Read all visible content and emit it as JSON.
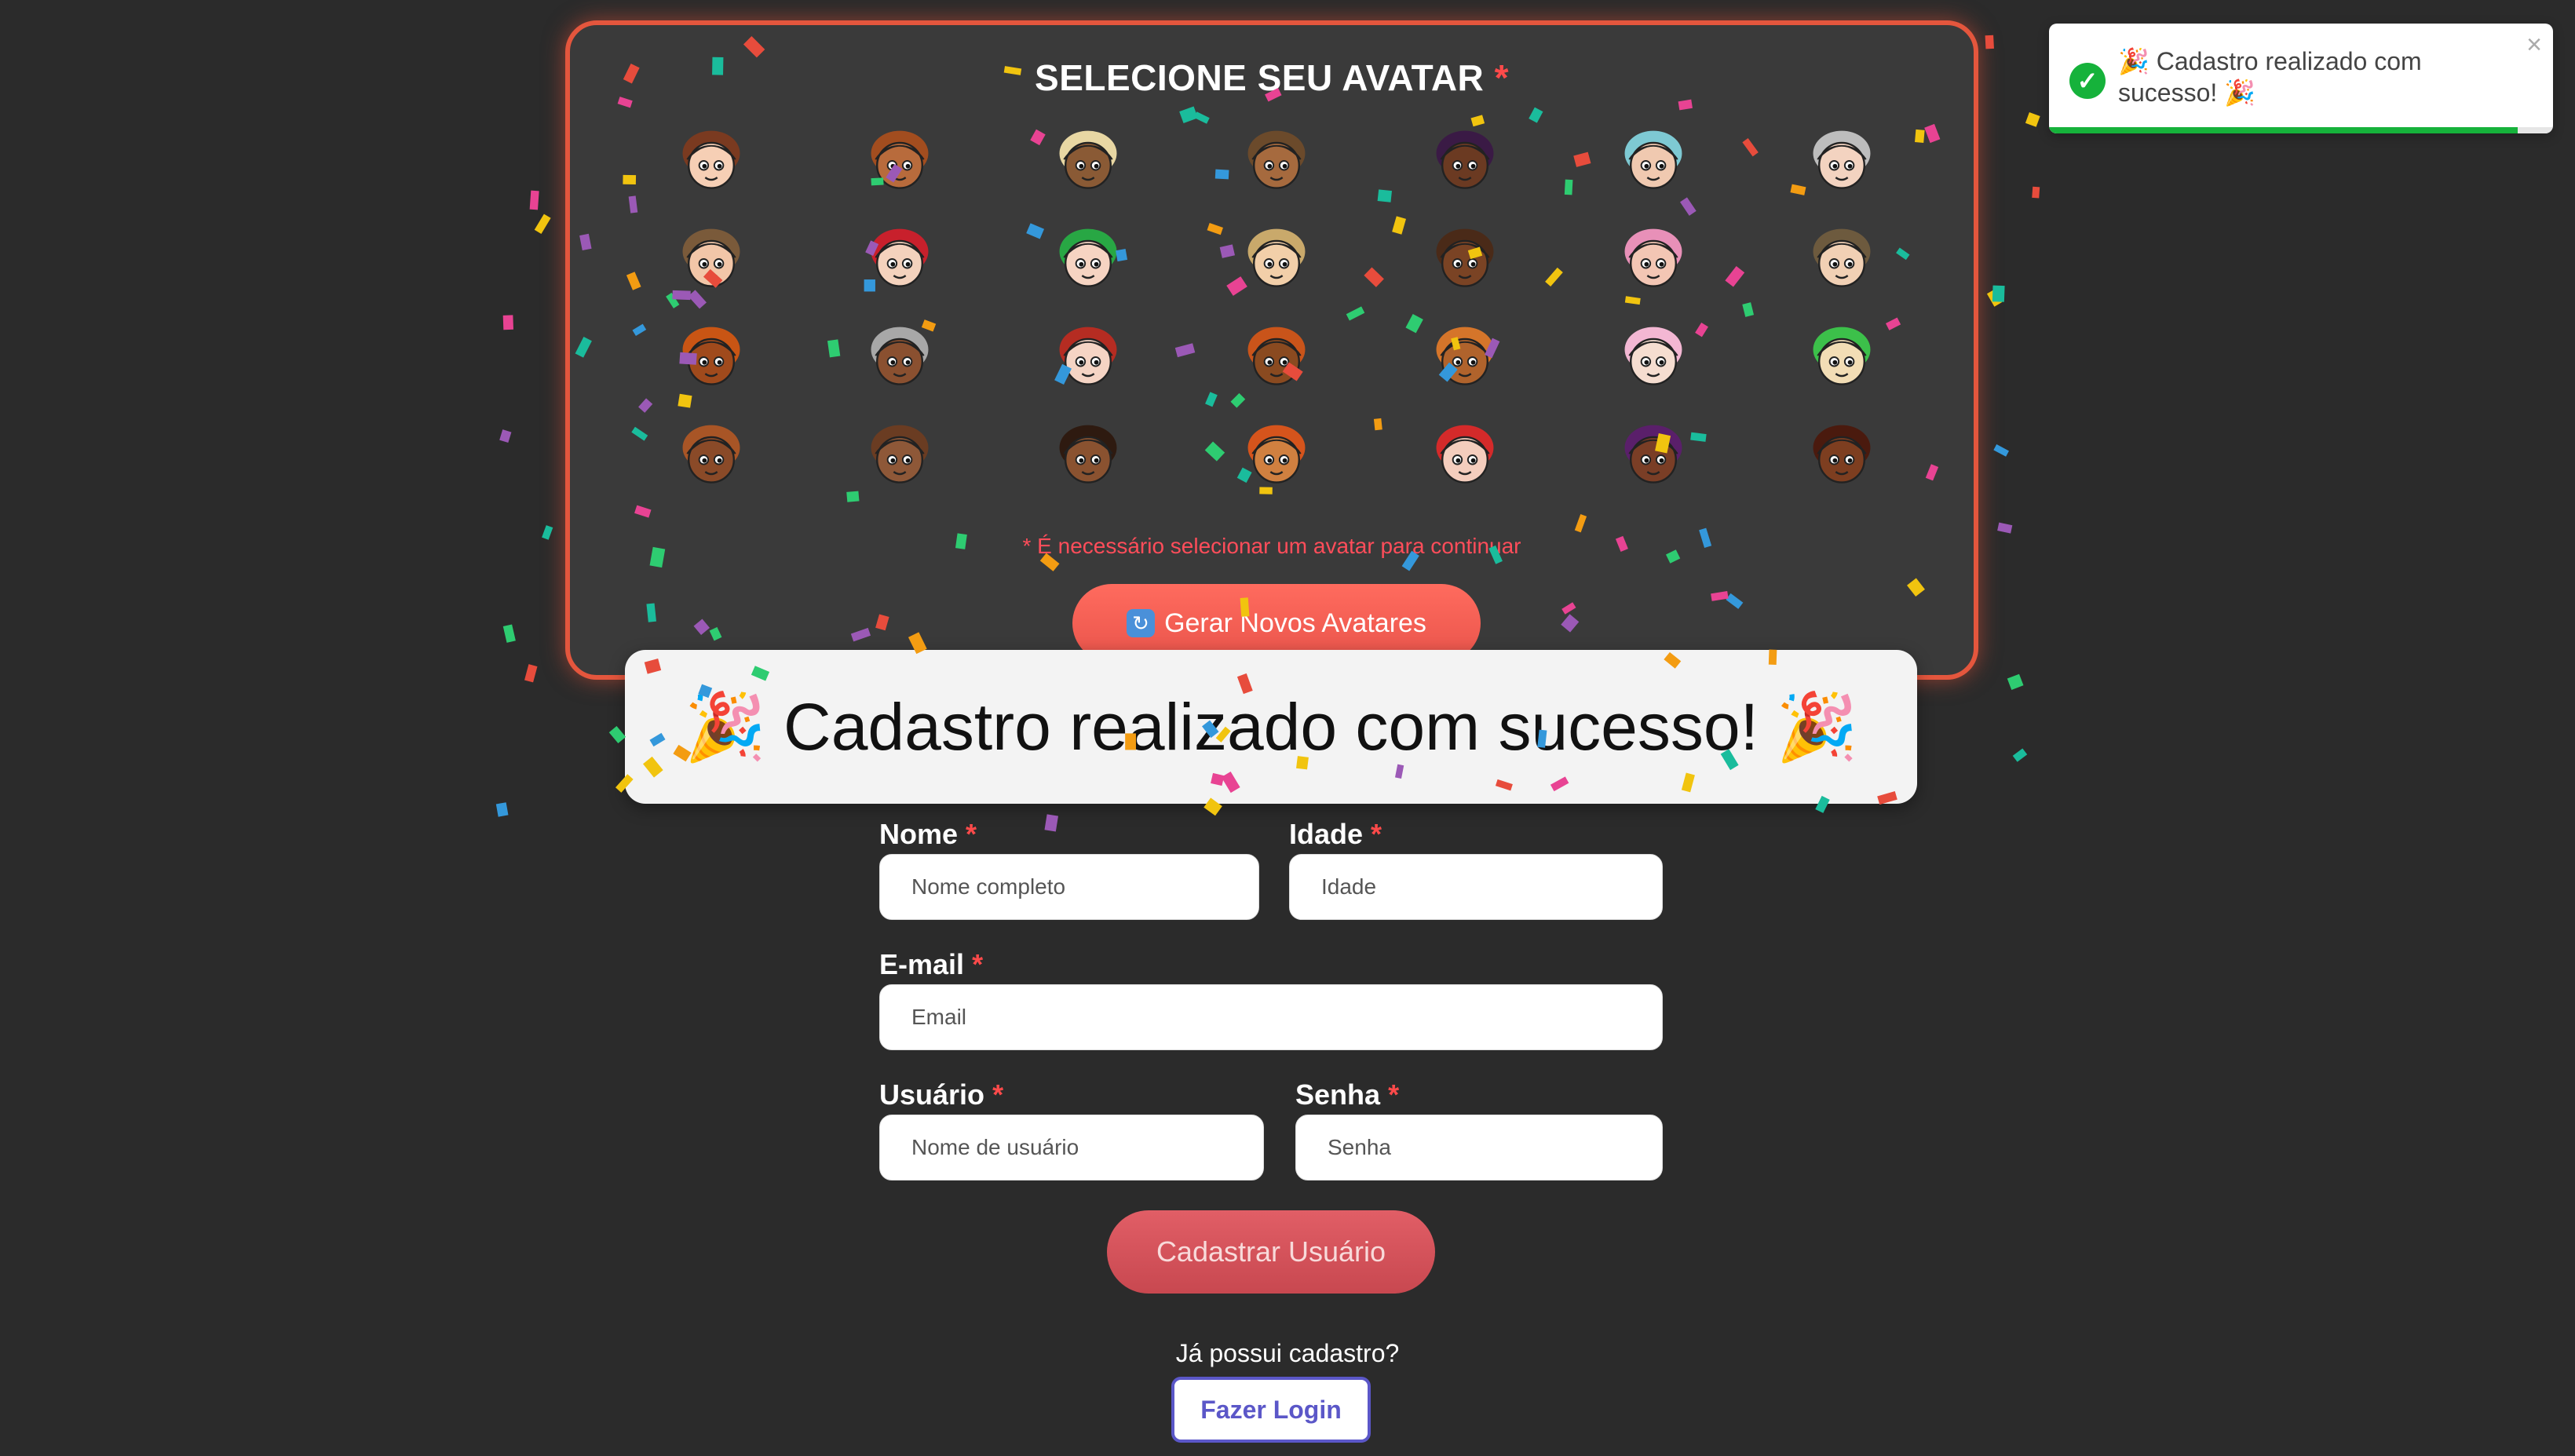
{
  "avatar_section": {
    "title": "SELECIONE SEU AVATAR",
    "required_mark": "*",
    "error_message": "* É necessário selecionar um avatar para continuar",
    "generate_button_label": "Gerar Novos Avatares",
    "generate_button_icon": "refresh-icon",
    "avatars": [
      {
        "skin": "#f6cfb5",
        "hair": "#7a3a20"
      },
      {
        "skin": "#b86b3c",
        "hair": "#a24d1f"
      },
      {
        "skin": "#8a5a35",
        "hair": "#e8d7a3"
      },
      {
        "skin": "#a66a3e",
        "hair": "#6b4a2b"
      },
      {
        "skin": "#6b3a22",
        "hair": "#3a1a45"
      },
      {
        "skin": "#f0c9b0",
        "hair": "#7ec9d3"
      },
      {
        "skin": "#f3d3c0",
        "hair": "#bdbdbd"
      },
      {
        "skin": "#f2c6a8",
        "hair": "#7a5a3a"
      },
      {
        "skin": "#f4d2bd",
        "hair": "#c8202c"
      },
      {
        "skin": "#f6d4c2",
        "hair": "#28a744"
      },
      {
        "skin": "#f2cfa9",
        "hair": "#c9a96b"
      },
      {
        "skin": "#7a4324",
        "hair": "#4a2a18"
      },
      {
        "skin": "#f3c6b4",
        "hair": "#e890b8"
      },
      {
        "skin": "#f1d0b4",
        "hair": "#6d5a3e"
      },
      {
        "skin": "#a04a1c",
        "hair": "#c95514"
      },
      {
        "skin": "#8a5030",
        "hair": "#a8a8a8"
      },
      {
        "skin": "#f5d4c4",
        "hair": "#b52c22"
      },
      {
        "skin": "#8a4a20",
        "hair": "#c9541a"
      },
      {
        "skin": "#b0632c",
        "hair": "#d5752a"
      },
      {
        "skin": "#f5ddd0",
        "hair": "#f3b7d3"
      },
      {
        "skin": "#f2ddb5",
        "hair": "#3cc04a"
      },
      {
        "skin": "#8a4a28",
        "hair": "#a85526"
      },
      {
        "skin": "#8e5838",
        "hair": "#6a3c22"
      },
      {
        "skin": "#8a5230",
        "hair": "#2e1a10"
      },
      {
        "skin": "#d08040",
        "hair": "#d5541c"
      },
      {
        "skin": "#f4cdbd",
        "hair": "#d42a2a"
      },
      {
        "skin": "#7a3e26",
        "hair": "#5a1f6a"
      },
      {
        "skin": "#7d3e20",
        "hair": "#4a1a0e"
      }
    ]
  },
  "banner": {
    "text": "Cadastro realizado com sucesso!",
    "left_icon": "party-popper-icon",
    "right_icon": "party-popper-icon"
  },
  "form": {
    "title": "Cadastrar Usuário",
    "required_mark": "*",
    "fields": {
      "nome": {
        "label": "Nome",
        "placeholder": "Nome completo"
      },
      "idade": {
        "label": "Idade",
        "placeholder": "Idade"
      },
      "email": {
        "label": "E-mail",
        "placeholder": "Email"
      },
      "usuario": {
        "label": "Usuário",
        "placeholder": "Nome de usuário"
      },
      "senha": {
        "label": "Senha",
        "placeholder": "Senha"
      }
    },
    "submit_label": "Cadastrar Usuário",
    "already_registered": "Já possui cadastro?",
    "login_label": "Fazer Login"
  },
  "toast": {
    "message": "🎉 Cadastro realizado com sucesso! 🎉",
    "icon": "check-circle-icon",
    "close_symbol": "×",
    "progress": 0.93
  },
  "colors": {
    "accent": "#e4563d",
    "error": "#ff4d5a",
    "success": "#16b23b",
    "login": "#5b57c8"
  }
}
